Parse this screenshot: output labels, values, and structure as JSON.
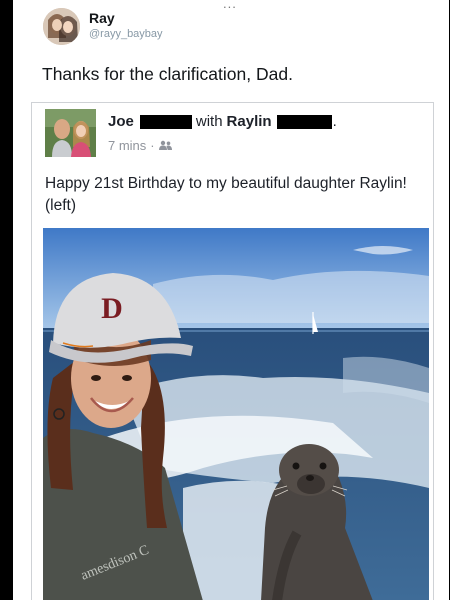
{
  "tweet": {
    "more_glyph": "...",
    "author_name": "Ray",
    "author_handle": "@rayy_baybay",
    "text": "Thanks for the clarification, Dad."
  },
  "embedded_post": {
    "author_name": "Joe",
    "with_word": "with",
    "tagged_name": "Raylin",
    "period": ".",
    "time": "7 mins",
    "separator": "·",
    "audience_icon": "friends-icon",
    "body_text": "Happy 21st Birthday to my beautiful daughter Raylin! (left)",
    "photo_cap_text": "D",
    "photo_shirt_text": "amesdison C"
  }
}
